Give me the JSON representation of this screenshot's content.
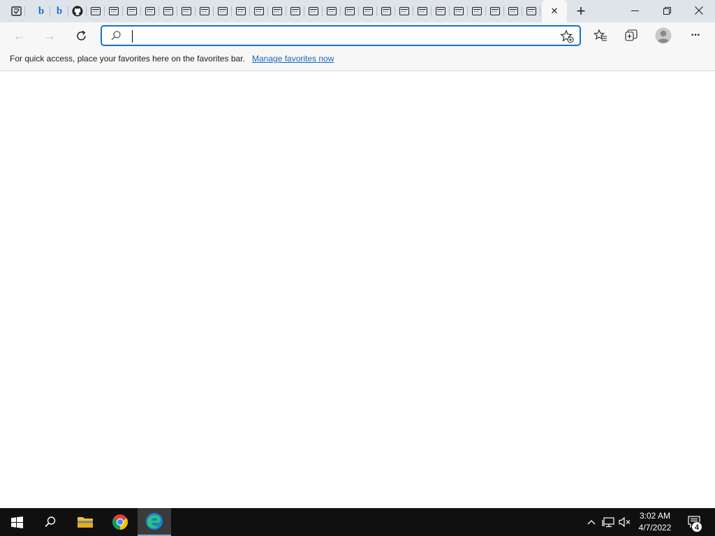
{
  "tabs": {
    "tab_icons": [
      "sticky-note-icon",
      "bing-icon",
      "bing-icon",
      "github-icon",
      "page-icon",
      "page-icon",
      "page-icon",
      "page-icon",
      "page-icon",
      "page-icon",
      "page-icon",
      "page-icon",
      "page-icon",
      "page-icon",
      "page-icon",
      "page-icon",
      "page-icon",
      "page-icon",
      "page-icon",
      "page-icon",
      "page-icon",
      "page-icon",
      "page-icon",
      "page-icon",
      "page-icon",
      "page-icon",
      "page-icon",
      "page-icon",
      "page-icon"
    ],
    "bing_letter": "b",
    "close_glyph": "✕",
    "new_tab_glyph": "+"
  },
  "window": {
    "minimize_glyph": "—",
    "restore_glyph": "❐",
    "close_glyph": "✕"
  },
  "toolbar": {
    "back_glyph": "←",
    "forward_glyph": "→",
    "refresh_glyph": "↻",
    "address_value": "",
    "address_placeholder": "",
    "more_glyph": "···"
  },
  "favorites_bar": {
    "message": "For quick access, place your favorites here on the favorites bar.",
    "link": "Manage favorites now"
  },
  "taskbar": {
    "clock_time": "3:02 AM",
    "clock_date": "4/7/2022",
    "notification_count": "4",
    "tray_chevron": "^",
    "accent_color": "#7aaed8"
  }
}
